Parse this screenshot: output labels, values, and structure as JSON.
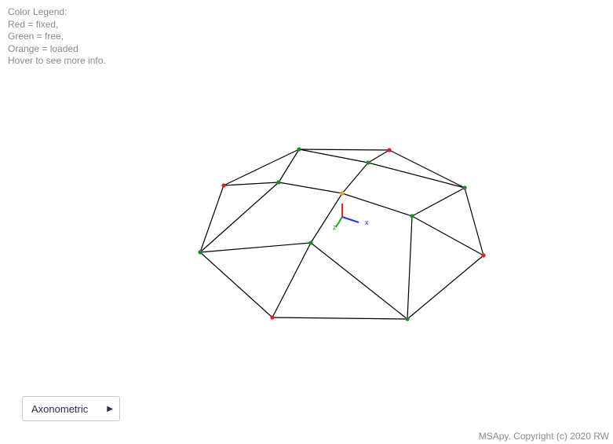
{
  "legend": {
    "title": "Color Legend:",
    "red": "Red = fixed,",
    "green": "Green = free,",
    "orange": "Orange = loaded",
    "hint": "Hover to see more info."
  },
  "view_menu": {
    "label": "Axonometric",
    "arrow": "▶"
  },
  "footer": {
    "copyright": "MSApy. Copyright (c) 2020 RW"
  },
  "axes": {
    "x_label": "x",
    "z_label": "z"
  },
  "colors": {
    "fixed": "#e02020",
    "free": "#1e8a1e",
    "loaded": "#f0a020",
    "member": "#000000",
    "axis_x": "#2233dd",
    "axis_y": "#dd2222",
    "axis_z": "#22aa22"
  }
}
